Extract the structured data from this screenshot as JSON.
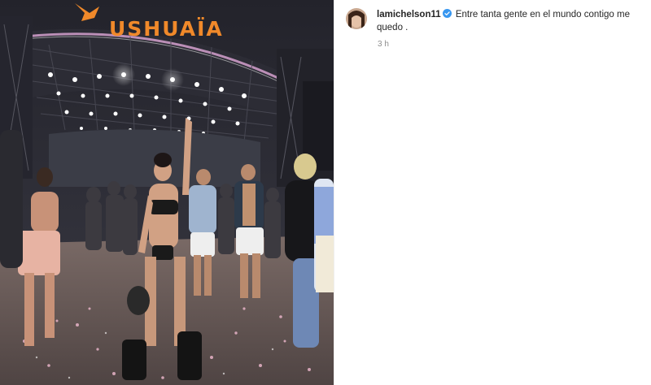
{
  "post": {
    "media": {
      "sign_text": "USHUAÏA"
    },
    "author": {
      "username": "lamichelson11",
      "verified": true,
      "avatar_icon": "profile-avatar"
    },
    "caption": "Entre tanta gente en el mundo contigo me quedo .",
    "timestamp": "3 h"
  },
  "colors": {
    "verified_badge": "#3897f0",
    "sign_orange": "#f0892a",
    "text_primary": "#262626",
    "text_secondary": "#8e8e8e"
  }
}
